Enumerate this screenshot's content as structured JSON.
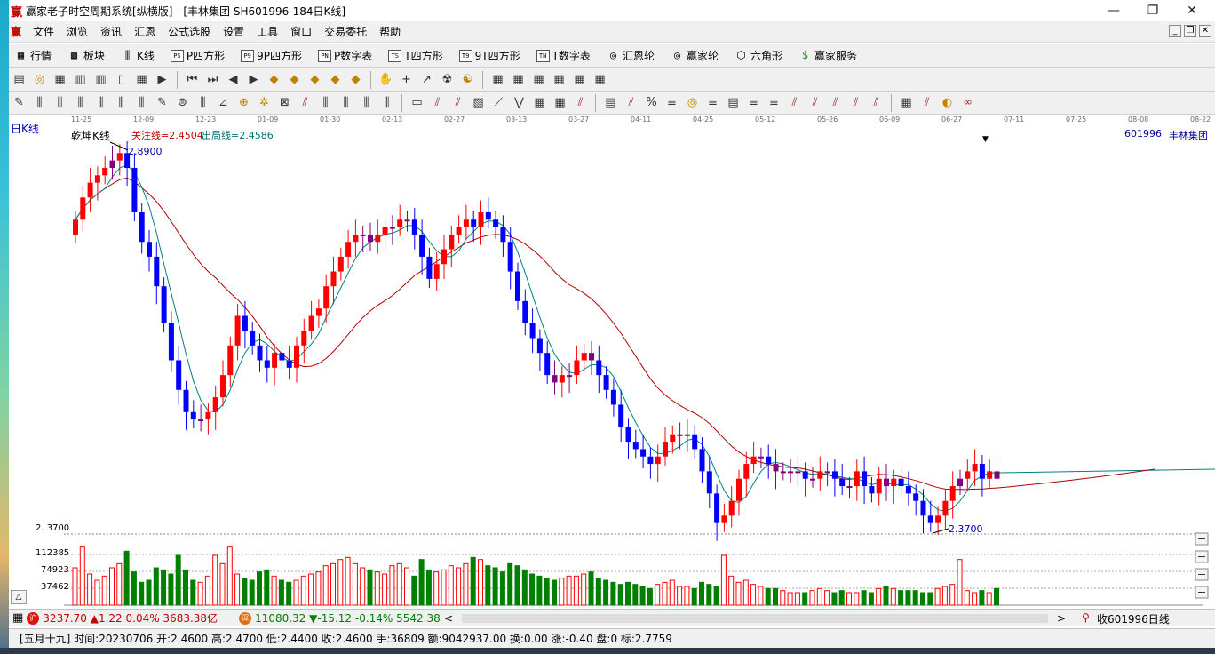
{
  "window": {
    "title": "赢家老子时空周期系统[纵横版] - [丰林集团  SH601996-184日K线]",
    "app_icon": "赢",
    "controls": {
      "minimize": "—",
      "restore": "❐",
      "close": "✕"
    }
  },
  "menubar": {
    "items": [
      "文件",
      "浏览",
      "资讯",
      "汇恩",
      "公式选股",
      "设置",
      "工具",
      "窗口",
      "交易委托",
      "帮助"
    ],
    "mdi": {
      "minimize": "_",
      "restore": "❐",
      "close": "✕"
    }
  },
  "toolbar1": {
    "items": [
      {
        "label": "行情",
        "icon": "grid-icon"
      },
      {
        "label": "板块",
        "icon": "blocks-icon"
      },
      {
        "label": "K线",
        "icon": "candles-icon"
      },
      {
        "label": "P四方形",
        "badge": "PS"
      },
      {
        "label": "9P四方形",
        "badge": "P9"
      },
      {
        "label": "P数字表",
        "badge": "PN"
      },
      {
        "label": "T四方形",
        "badge": "TS"
      },
      {
        "label": "9T四方形",
        "badge": "T9"
      },
      {
        "label": "T数字表",
        "badge": "TN"
      },
      {
        "label": "汇恩轮",
        "icon": "wheel-icon"
      },
      {
        "label": "赢家轮",
        "icon": "wheel-icon"
      },
      {
        "label": "六角形",
        "icon": "hexagon-icon"
      },
      {
        "label": "赢家服务",
        "icon": "dollar-icon"
      }
    ]
  },
  "toolbar2": {
    "groups": [
      [
        "▤",
        "◎",
        "▦",
        "▥",
        "▥",
        "▯",
        "▦",
        "▶"
      ],
      [
        "⏮",
        "⏭",
        "◀",
        "▶",
        "◆",
        "◆",
        "◆",
        "◆",
        "◆"
      ],
      [
        "✋",
        "+",
        "↗",
        "☢",
        "☯"
      ],
      [
        "▦",
        "▦",
        "▦",
        "▦",
        "▦",
        "▦"
      ]
    ]
  },
  "toolbar3": {
    "groups": [
      [
        "✎",
        "⫼",
        "⫼",
        "⫼",
        "⫼",
        "⫼",
        "⫼",
        "✎",
        "⊜",
        "⫼",
        "⊿",
        "⊕",
        "✲",
        "⊠",
        "⫽",
        "⫼",
        "⫼",
        "⫼",
        "⫼"
      ],
      [
        "▭",
        "⫽",
        "⫽",
        "▧",
        "⟋",
        "⋁",
        "▦",
        "▦",
        "⫽"
      ],
      [
        "▤",
        "⫽",
        "%",
        "≡",
        "◎",
        "≡",
        "▤",
        "≡",
        "≡",
        "⫽",
        "⫽",
        "⫽",
        "⫽",
        "⫽"
      ],
      [
        "▦",
        "⫽",
        "◐",
        "∞"
      ]
    ]
  },
  "datebar": {
    "dates": [
      "11-25",
      "12-09",
      "12-23",
      "01-09",
      "01-30",
      "02-13",
      "02-27",
      "03-13",
      "03-27",
      "04-11",
      "04-25",
      "05-12",
      "05-26",
      "06-09",
      "06-27",
      "07-11",
      "07-25",
      "08-08",
      "08-22"
    ]
  },
  "chart_header": {
    "period_label": "日K线",
    "indicator_name": "乾坤K线",
    "watch_line": "关注线=2.4504",
    "exit_line": "出局线=2.4586",
    "stock_code": "601996",
    "stock_name": "丰林集团",
    "dropdown_arrow": "▼"
  },
  "chart_data": {
    "type": "candlestick",
    "period": "日K线",
    "indicator": "乾坤K线",
    "x_dates": [
      "11-25",
      "12-09",
      "12-23",
      "01-09",
      "01-30",
      "02-13",
      "02-27",
      "03-13",
      "03-27",
      "04-11",
      "04-25",
      "05-12",
      "05-26",
      "06-09",
      "06-27",
      "07-11",
      "07-25",
      "08-08",
      "08-22"
    ],
    "max_label": "2.8900",
    "min_label": "2.3700",
    "price_axis_label": "2. 3700",
    "volume_ticks": [
      "112385",
      "74923",
      "37462"
    ],
    "colors": {
      "up": "#ff0000",
      "down": "#0000ff",
      "neutral": "#800080",
      "ma_fast": "#008080",
      "ma_slow": "#b00000",
      "vol_up": "#ff0000",
      "vol_down": "#008000"
    },
    "close_series": [
      2.79,
      2.82,
      2.84,
      2.85,
      2.86,
      2.87,
      2.88,
      2.86,
      2.8,
      2.76,
      2.74,
      2.7,
      2.65,
      2.6,
      2.56,
      2.53,
      2.52,
      2.52,
      2.53,
      2.55,
      2.58,
      2.62,
      2.66,
      2.64,
      2.62,
      2.6,
      2.59,
      2.61,
      2.6,
      2.59,
      2.62,
      2.64,
      2.66,
      2.67,
      2.7,
      2.72,
      2.74,
      2.76,
      2.77,
      2.77,
      2.76,
      2.77,
      2.78,
      2.78,
      2.79,
      2.79,
      2.77,
      2.74,
      2.71,
      2.73,
      2.75,
      2.77,
      2.78,
      2.79,
      2.78,
      2.8,
      2.79,
      2.78,
      2.76,
      2.72,
      2.68,
      2.65,
      2.63,
      2.61,
      2.58,
      2.57,
      2.58,
      2.58,
      2.6,
      2.61,
      2.6,
      2.58,
      2.56,
      2.54,
      2.51,
      2.49,
      2.48,
      2.47,
      2.46,
      2.47,
      2.49,
      2.5,
      2.5,
      2.5,
      2.48,
      2.45,
      2.42,
      2.38,
      2.39,
      2.41,
      2.44,
      2.46,
      2.47,
      2.47,
      2.46,
      2.45,
      2.45,
      2.45,
      2.45,
      2.44,
      2.44,
      2.45,
      2.45,
      2.44,
      2.43,
      2.43,
      2.45,
      2.43,
      2.42,
      2.44,
      2.43,
      2.44,
      2.43,
      2.42,
      2.41,
      2.39,
      2.38,
      2.39,
      2.41,
      2.43,
      2.44,
      2.45,
      2.46,
      2.44,
      2.45,
      2.44
    ],
    "open_series": [
      2.77,
      2.79,
      2.82,
      2.84,
      2.85,
      2.86,
      2.87,
      2.88,
      2.86,
      2.8,
      2.76,
      2.74,
      2.7,
      2.65,
      2.6,
      2.56,
      2.53,
      2.52,
      2.52,
      2.53,
      2.55,
      2.58,
      2.62,
      2.66,
      2.64,
      2.62,
      2.6,
      2.59,
      2.61,
      2.6,
      2.59,
      2.62,
      2.64,
      2.66,
      2.67,
      2.7,
      2.72,
      2.74,
      2.76,
      2.77,
      2.77,
      2.76,
      2.77,
      2.78,
      2.78,
      2.79,
      2.79,
      2.77,
      2.74,
      2.71,
      2.73,
      2.75,
      2.77,
      2.78,
      2.79,
      2.78,
      2.8,
      2.79,
      2.78,
      2.76,
      2.72,
      2.68,
      2.65,
      2.63,
      2.61,
      2.58,
      2.57,
      2.58,
      2.58,
      2.6,
      2.61,
      2.6,
      2.58,
      2.56,
      2.54,
      2.51,
      2.49,
      2.48,
      2.47,
      2.46,
      2.47,
      2.49,
      2.5,
      2.5,
      2.5,
      2.48,
      2.45,
      2.42,
      2.38,
      2.39,
      2.41,
      2.44,
      2.46,
      2.47,
      2.47,
      2.46,
      2.45,
      2.45,
      2.45,
      2.45,
      2.44,
      2.44,
      2.45,
      2.45,
      2.44,
      2.43,
      2.43,
      2.45,
      2.43,
      2.42,
      2.44,
      2.43,
      2.44,
      2.43,
      2.42,
      2.41,
      2.39,
      2.38,
      2.39,
      2.41,
      2.43,
      2.44,
      2.45,
      2.46,
      2.44,
      2.45
    ],
    "volume_series": [
      90,
      140,
      75,
      60,
      70,
      90,
      100,
      130,
      80,
      55,
      60,
      90,
      85,
      75,
      120,
      85,
      60,
      55,
      70,
      120,
      100,
      140,
      75,
      65,
      60,
      80,
      85,
      70,
      60,
      55,
      60,
      70,
      75,
      80,
      95,
      100,
      110,
      115,
      100,
      90,
      85,
      80,
      75,
      95,
      100,
      90,
      70,
      110,
      85,
      80,
      85,
      95,
      90,
      100,
      115,
      110,
      95,
      90,
      80,
      100,
      95,
      85,
      75,
      70,
      65,
      60,
      65,
      70,
      70,
      75,
      80,
      65,
      60,
      55,
      50,
      55,
      50,
      45,
      40,
      50,
      55,
      60,
      45,
      45,
      40,
      55,
      50,
      45,
      120,
      70,
      55,
      60,
      50,
      45,
      40,
      40,
      35,
      30,
      30,
      30,
      35,
      40,
      35,
      30,
      35,
      30,
      30,
      35,
      30,
      40,
      45,
      40,
      35,
      35,
      35,
      30,
      30,
      40,
      45,
      50,
      110,
      35,
      30,
      35,
      30,
      40
    ]
  },
  "status1": {
    "sh_badge": "沪",
    "sh_text": "3237.70 ▲1.22 0.04% 3683.38亿",
    "sz_badge": "深",
    "sz_text": "11080.32 ▼-15.12 -0.14% 5542.38",
    "scroll_left": "<",
    "scroll_right": ">",
    "right_text": "收601996日线"
  },
  "status2": {
    "text": "[五月十九] 时间:20230706 开:2.4600 高:2.4700 低:2.4400 收:2.4600 手:36809 额:9042937.00 换:0.00 涨:-0.40 盘:0 标:2.7759"
  }
}
